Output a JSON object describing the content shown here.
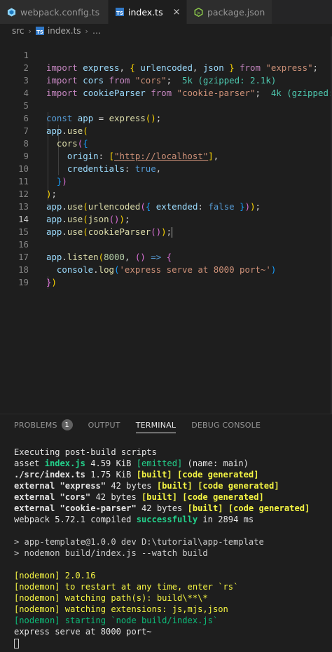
{
  "tabs": [
    {
      "label": "webpack.config.ts",
      "icon": "webpack-icon",
      "active": false
    },
    {
      "label": "index.ts",
      "icon": "typescript-icon",
      "active": true,
      "close": "×"
    },
    {
      "label": "package.json",
      "icon": "nodejs-icon",
      "active": false
    }
  ],
  "breadcrumb": {
    "folder": "src",
    "file": "index.ts",
    "more": "…",
    "sep": "›"
  },
  "editor": {
    "current_line": 14,
    "lines": [
      {
        "n": "1"
      },
      {
        "n": "2"
      },
      {
        "n": "3"
      },
      {
        "n": "4"
      },
      {
        "n": "5"
      },
      {
        "n": "6"
      },
      {
        "n": "7"
      },
      {
        "n": "8"
      },
      {
        "n": "9"
      },
      {
        "n": "10"
      },
      {
        "n": "11"
      },
      {
        "n": "12"
      },
      {
        "n": "13"
      },
      {
        "n": "14"
      },
      {
        "n": "15"
      },
      {
        "n": "16"
      },
      {
        "n": "17"
      },
      {
        "n": "18"
      },
      {
        "n": "19"
      }
    ],
    "tokens": {
      "import": "import",
      "from": "from",
      "const": "const",
      "true": "true",
      "false": "false",
      "express": "express",
      "urlencoded": "urlencoded",
      "json": "json",
      "cors": "cors",
      "cookieParser": "cookieParser",
      "app": "app",
      "use": "use",
      "origin": "origin",
      "credentials": "credentials",
      "extended": "extended",
      "listen": "listen",
      "console": "console",
      "log": "log",
      "s_express": "\"express\"",
      "s_cors": "\"cors\"",
      "s_cookie": "\"cookie-parser\"",
      "s_localhost": "\"http://localhost\"",
      "s_msg": "'express serve at 8000 port~'",
      "n8000": "8000",
      "hint_cors": "5k (gzipped: 2.1k)",
      "hint_cookie": "4k (gzipped:"
    }
  },
  "panel": {
    "tabs": [
      "PROBLEMS",
      "OUTPUT",
      "TERMINAL",
      "DEBUG CONSOLE"
    ],
    "problems_count": "1",
    "active_tab": "TERMINAL"
  },
  "terminal": {
    "l1": "Executing post-build scripts",
    "l2a": "asset ",
    "l2b": "index.js",
    "l2c": " 4.59 KiB ",
    "l2d": "[emitted]",
    "l2e": " (name: main)",
    "l3a": "./src/index.ts",
    "l3b": " 1.75 KiB ",
    "l3c": "[built] [code generated]",
    "l4a": "external \"express\"",
    "l4b": " 42 bytes ",
    "l4c": "[built] [code generated]",
    "l5a": "external \"cors\"",
    "l5b": " 42 bytes ",
    "l5c": "[built] [code generated]",
    "l6a": "external \"cookie-parser\"",
    "l6b": " 42 bytes ",
    "l6c": "[built] [code generated]",
    "l7a": "webpack 5.72.1 compiled ",
    "l7b": "successfully",
    "l7c": " in 2894 ms",
    "l8": "> app-template@1.0.0 dev D:\\tutorial\\app-template",
    "l9": "> nodemon build/index.js --watch build",
    "l10": "[nodemon] 2.0.16",
    "l11": "[nodemon] to restart at any time, enter `rs`",
    "l12": "[nodemon] watching path(s): build\\**\\*",
    "l13": "[nodemon] watching extensions: js,mjs,json",
    "l14": "[nodemon] starting `node build/index.js`",
    "l15": "express serve at 8000 port~"
  },
  "colors": {
    "keyword": "#c586c0",
    "storage": "#569cd6",
    "variable": "#9cdcfe",
    "function": "#dcdcaa",
    "string": "#ce9178",
    "number": "#b5cea8",
    "hint": "#4ec9b0",
    "terminal_green": "#23d18b",
    "terminal_yellow": "#f5f543"
  }
}
